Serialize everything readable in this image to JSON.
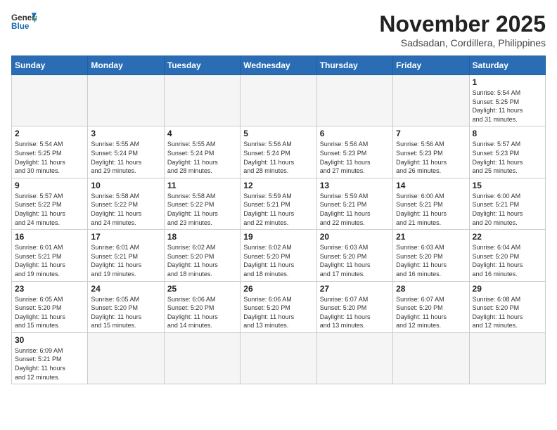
{
  "header": {
    "logo_general": "General",
    "logo_blue": "Blue",
    "month_title": "November 2025",
    "subtitle": "Sadsadan, Cordillera, Philippines"
  },
  "weekdays": [
    "Sunday",
    "Monday",
    "Tuesday",
    "Wednesday",
    "Thursday",
    "Friday",
    "Saturday"
  ],
  "weeks": [
    [
      {
        "day": "",
        "info": ""
      },
      {
        "day": "",
        "info": ""
      },
      {
        "day": "",
        "info": ""
      },
      {
        "day": "",
        "info": ""
      },
      {
        "day": "",
        "info": ""
      },
      {
        "day": "",
        "info": ""
      },
      {
        "day": "1",
        "info": "Sunrise: 5:54 AM\nSunset: 5:25 PM\nDaylight: 11 hours\nand 31 minutes."
      }
    ],
    [
      {
        "day": "2",
        "info": "Sunrise: 5:54 AM\nSunset: 5:25 PM\nDaylight: 11 hours\nand 30 minutes."
      },
      {
        "day": "3",
        "info": "Sunrise: 5:55 AM\nSunset: 5:24 PM\nDaylight: 11 hours\nand 29 minutes."
      },
      {
        "day": "4",
        "info": "Sunrise: 5:55 AM\nSunset: 5:24 PM\nDaylight: 11 hours\nand 28 minutes."
      },
      {
        "day": "5",
        "info": "Sunrise: 5:56 AM\nSunset: 5:24 PM\nDaylight: 11 hours\nand 28 minutes."
      },
      {
        "day": "6",
        "info": "Sunrise: 5:56 AM\nSunset: 5:23 PM\nDaylight: 11 hours\nand 27 minutes."
      },
      {
        "day": "7",
        "info": "Sunrise: 5:56 AM\nSunset: 5:23 PM\nDaylight: 11 hours\nand 26 minutes."
      },
      {
        "day": "8",
        "info": "Sunrise: 5:57 AM\nSunset: 5:23 PM\nDaylight: 11 hours\nand 25 minutes."
      }
    ],
    [
      {
        "day": "9",
        "info": "Sunrise: 5:57 AM\nSunset: 5:22 PM\nDaylight: 11 hours\nand 24 minutes."
      },
      {
        "day": "10",
        "info": "Sunrise: 5:58 AM\nSunset: 5:22 PM\nDaylight: 11 hours\nand 24 minutes."
      },
      {
        "day": "11",
        "info": "Sunrise: 5:58 AM\nSunset: 5:22 PM\nDaylight: 11 hours\nand 23 minutes."
      },
      {
        "day": "12",
        "info": "Sunrise: 5:59 AM\nSunset: 5:21 PM\nDaylight: 11 hours\nand 22 minutes."
      },
      {
        "day": "13",
        "info": "Sunrise: 5:59 AM\nSunset: 5:21 PM\nDaylight: 11 hours\nand 22 minutes."
      },
      {
        "day": "14",
        "info": "Sunrise: 6:00 AM\nSunset: 5:21 PM\nDaylight: 11 hours\nand 21 minutes."
      },
      {
        "day": "15",
        "info": "Sunrise: 6:00 AM\nSunset: 5:21 PM\nDaylight: 11 hours\nand 20 minutes."
      }
    ],
    [
      {
        "day": "16",
        "info": "Sunrise: 6:01 AM\nSunset: 5:21 PM\nDaylight: 11 hours\nand 19 minutes."
      },
      {
        "day": "17",
        "info": "Sunrise: 6:01 AM\nSunset: 5:21 PM\nDaylight: 11 hours\nand 19 minutes."
      },
      {
        "day": "18",
        "info": "Sunrise: 6:02 AM\nSunset: 5:20 PM\nDaylight: 11 hours\nand 18 minutes."
      },
      {
        "day": "19",
        "info": "Sunrise: 6:02 AM\nSunset: 5:20 PM\nDaylight: 11 hours\nand 18 minutes."
      },
      {
        "day": "20",
        "info": "Sunrise: 6:03 AM\nSunset: 5:20 PM\nDaylight: 11 hours\nand 17 minutes."
      },
      {
        "day": "21",
        "info": "Sunrise: 6:03 AM\nSunset: 5:20 PM\nDaylight: 11 hours\nand 16 minutes."
      },
      {
        "day": "22",
        "info": "Sunrise: 6:04 AM\nSunset: 5:20 PM\nDaylight: 11 hours\nand 16 minutes."
      }
    ],
    [
      {
        "day": "23",
        "info": "Sunrise: 6:05 AM\nSunset: 5:20 PM\nDaylight: 11 hours\nand 15 minutes."
      },
      {
        "day": "24",
        "info": "Sunrise: 6:05 AM\nSunset: 5:20 PM\nDaylight: 11 hours\nand 15 minutes."
      },
      {
        "day": "25",
        "info": "Sunrise: 6:06 AM\nSunset: 5:20 PM\nDaylight: 11 hours\nand 14 minutes."
      },
      {
        "day": "26",
        "info": "Sunrise: 6:06 AM\nSunset: 5:20 PM\nDaylight: 11 hours\nand 13 minutes."
      },
      {
        "day": "27",
        "info": "Sunrise: 6:07 AM\nSunset: 5:20 PM\nDaylight: 11 hours\nand 13 minutes."
      },
      {
        "day": "28",
        "info": "Sunrise: 6:07 AM\nSunset: 5:20 PM\nDaylight: 11 hours\nand 12 minutes."
      },
      {
        "day": "29",
        "info": "Sunrise: 6:08 AM\nSunset: 5:20 PM\nDaylight: 11 hours\nand 12 minutes."
      }
    ],
    [
      {
        "day": "30",
        "info": "Sunrise: 6:09 AM\nSunset: 5:21 PM\nDaylight: 11 hours\nand 12 minutes."
      },
      {
        "day": "",
        "info": ""
      },
      {
        "day": "",
        "info": ""
      },
      {
        "day": "",
        "info": ""
      },
      {
        "day": "",
        "info": ""
      },
      {
        "day": "",
        "info": ""
      },
      {
        "day": "",
        "info": ""
      }
    ]
  ]
}
